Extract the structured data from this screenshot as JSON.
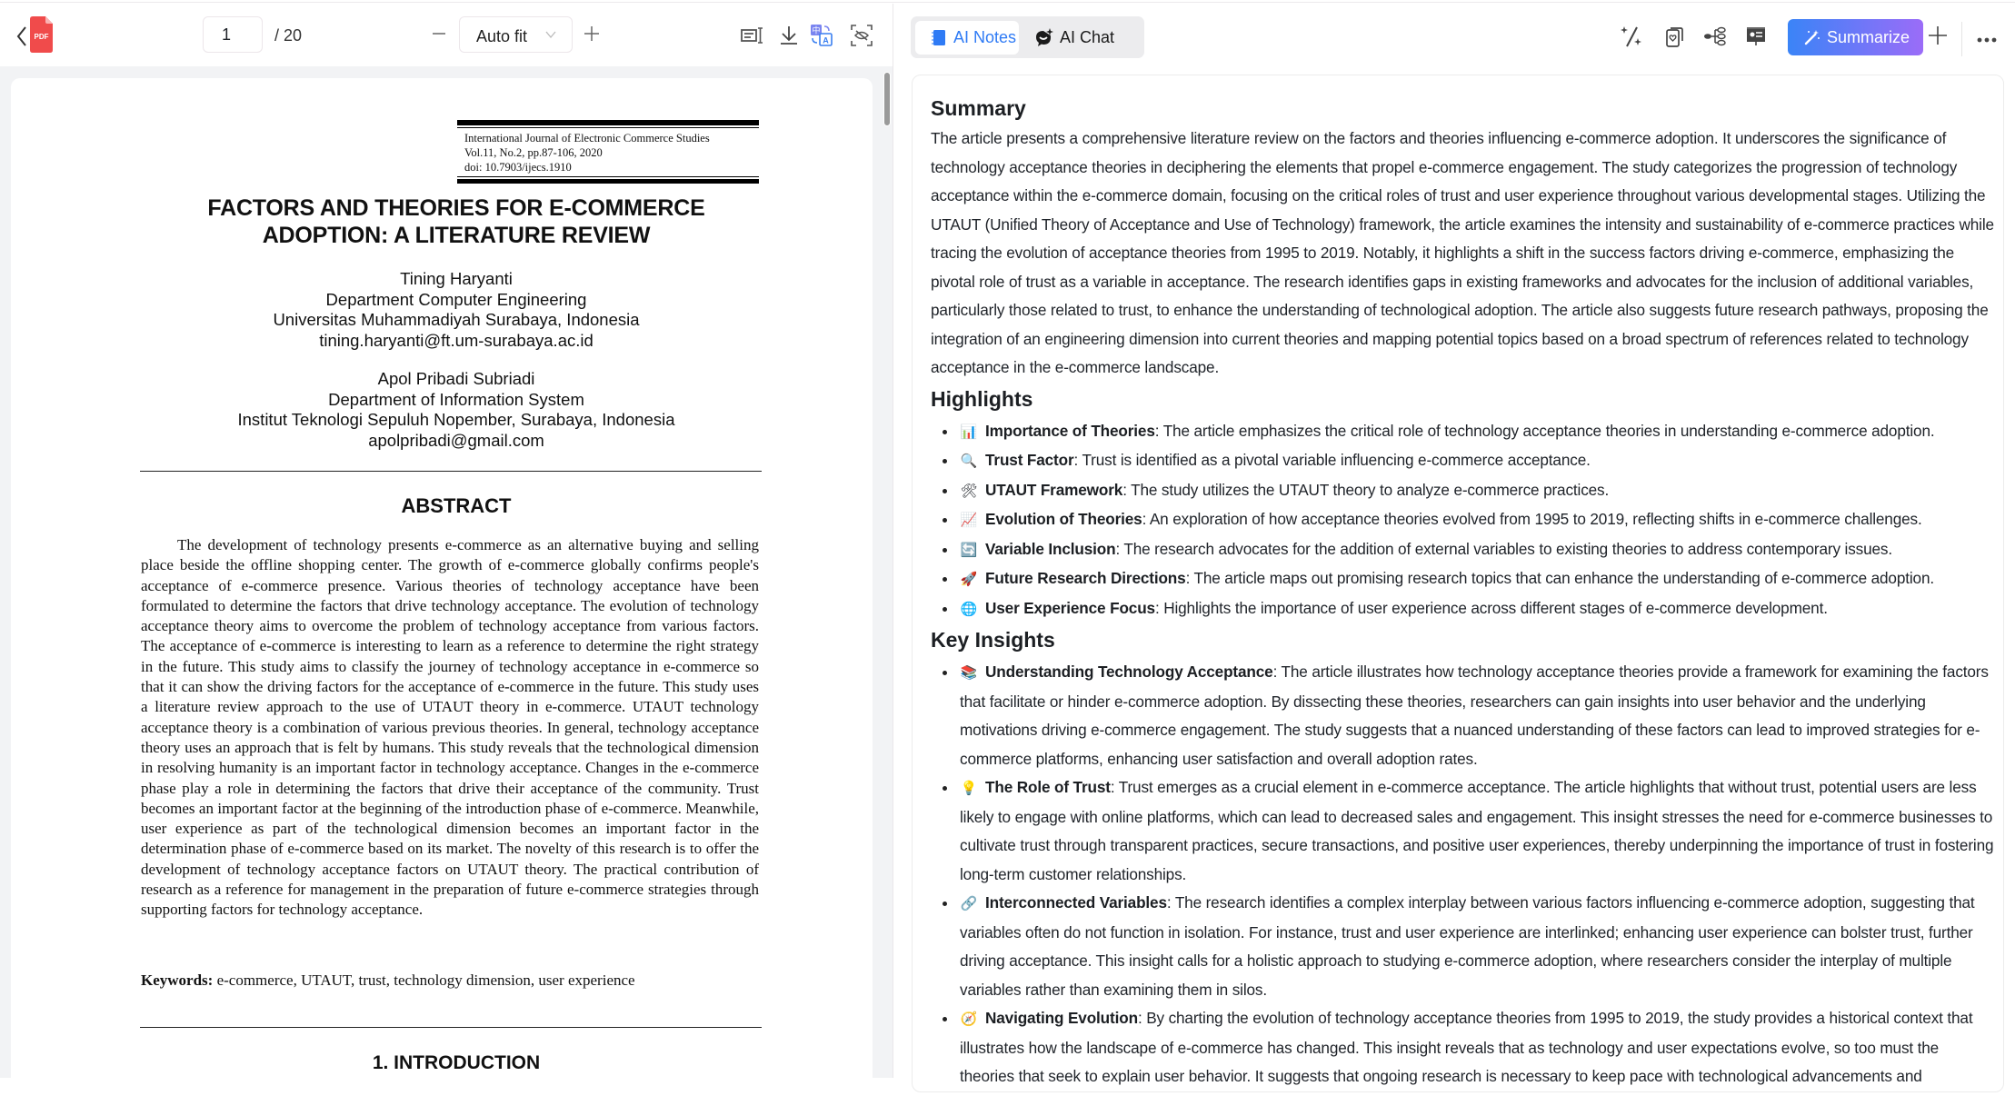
{
  "pdf_viewer": {
    "file_type_badge": "PDF",
    "current_page": "1",
    "total_pages": "/ 20",
    "zoom_level": "Auto fit",
    "toolbar_icons": [
      "text-select-icon",
      "download-icon",
      "translate-icon",
      "hide-icon"
    ]
  },
  "paper": {
    "journal": "International Journal of Electronic Commerce Studies",
    "volume": "Vol.11, No.2, pp.87-106, 2020",
    "doi": "doi: 10.7903/ijecs.1910",
    "title_line1": "FACTORS AND THEORIES FOR E-COMMERCE",
    "title_line2": "ADOPTION: A LITERATURE REVIEW",
    "authors": [
      {
        "name": "Tining Haryanti",
        "department": "Department Computer Engineering",
        "institution": "Universitas Muhammadiyah Surabaya, Indonesia",
        "email": "tining.haryanti@ft.um-surabaya.ac.id"
      },
      {
        "name": "Apol Pribadi Subriadi",
        "department": "Department of Information System",
        "institution": "Institut Teknologi Sepuluh Nopember, Surabaya, Indonesia",
        "email": "apolpribadi@gmail.com"
      }
    ],
    "abstract_heading": "ABSTRACT",
    "abstract": "The development of technology presents e-commerce as an alternative buying and selling place beside the offline shopping center. The growth of e-commerce globally confirms people's acceptance of e-commerce presence. Various theories of technology acceptance have been formulated to determine the factors that drive technology acceptance. The evolution of technology acceptance theory aims to overcome the problem of technology acceptance from various factors. The acceptance of e-commerce is interesting to learn as a reference to determine the right strategy in the future. This study aims to classify the journey of technology acceptance in e-commerce so that it can show the driving factors for the acceptance of e-commerce in the future. This study uses a literature review approach to the use of UTAUT theory in e-commerce. UTAUT technology acceptance theory is a combination of various previous theories. In general, technology acceptance theory uses an approach that is felt by humans. This study reveals that the technological dimension in resolving humanity is an important factor in technology acceptance. Changes in the e-commerce phase play a role in determining the factors that drive their acceptance of the community. Trust becomes an important factor at the beginning of the introduction phase of e-commerce. Meanwhile, user experience as part of the technological dimension becomes an important factor in the determination phase of e-commerce based on its market. The novelty of this research is to offer the development of technology acceptance factors on UTAUT theory. The practical contribution of research as a reference for management in the preparation of future e-commerce strategies through supporting factors for technology acceptance.",
    "keywords_label": "Keywords:",
    "keywords": " e-commerce, UTAUT, trust, technology dimension, user experience",
    "section1_heading": "1. INTRODUCTION"
  },
  "ai_panel": {
    "tabs": [
      {
        "label": "AI Notes",
        "active": true,
        "icon": "notebook-icon"
      },
      {
        "label": "AI Chat",
        "active": false,
        "icon": "chat-sparkle-icon"
      }
    ],
    "toolbar_icons": [
      "magic-sparkle-icon",
      "flashcards-icon",
      "mindmap-icon",
      "presentation-icon"
    ],
    "summarize_label": "Summarize",
    "accent_gradient": [
      "#3a84f7",
      "#9b6cf8"
    ],
    "active_tab_color": "#2f7bf5"
  },
  "notes": {
    "summary_heading": "Summary",
    "summary": "The article presents a comprehensive literature review on the factors and theories influencing e-commerce adoption. It underscores the significance of technology acceptance theories in deciphering the elements that propel e-commerce engagement. The study categorizes the progression of technol­ogy acceptance within the e-commerce domain, focusing on the critical roles of trust and user experience throughout various developmental stages. Utilizing the UTAUT (Unified Theory of Acceptance and Use of Technology) framework, the article examines the intensity and sustainability of e-com­merce practices while tracing the evolution of acceptance theories from 1995 to 2019. Notably, it highlights a shift in the success factors driving e-commerce, emphasizing the pivotal role of trust as a variable in acceptance. The research identifies gaps in existing frameworks and advocates for the inclusion of additional variables, particularly those related to trust, to enhance the understanding of technological adoption. The article also sug­gests future research pathways, proposing the integration of an engineering dimension into current theories and mapping potential topics based on a broad spectrum of references related to technology acceptance in the e-commerce landscape.",
    "highlights_heading": "Highlights",
    "highlights": [
      {
        "emoji": "📊",
        "title": "Importance of Theories",
        "text": ": The article emphasizes the critical role of technology acceptance theories in understanding e-commerce adoption."
      },
      {
        "emoji": "🔍",
        "title": "Trust Factor",
        "text": ": Trust is identified as a pivotal variable influencing e-commerce acceptance."
      },
      {
        "emoji": "🛠",
        "title": "UTAUT Framework",
        "text": ": The study utilizes the UTAUT theory to analyze e-commerce practices."
      },
      {
        "emoji": "📈",
        "title": "Evolution of Theories",
        "text": ": An exploration of how acceptance theories evolved from 1995 to 2019, reflecting shifts in e-commerce challenges."
      },
      {
        "emoji": "🔄",
        "title": "Variable Inclusion",
        "text": ": The research advocates for the addition of external variables to existing theories to address contemporary issues."
      },
      {
        "emoji": "🚀",
        "title": "Future Research Directions",
        "text": ": The article maps out promising research topics that can enhance the understanding of e-commerce adoption."
      },
      {
        "emoji": "🌐",
        "title": "User Experience Focus",
        "text": ": Highlights the importance of user experience across different stages of e-commerce development."
      }
    ],
    "insights_heading": "Key Insights",
    "insights": [
      {
        "emoji": "📚",
        "title": "Understanding Technology Acceptance",
        "text": ": The article illustrates how technology acceptance theories provide a framework for examining the factors that facilitate or hinder e-commerce adoption. By dissecting these theories, researchers can gain insights into user behavior and the un­derlying motivations driving e-commerce engagement. The study suggests that a nuanced understanding of these factors can lead to improved strategies for e-commerce platforms, enhancing user satisfaction and overall adoption rates."
      },
      {
        "emoji": "💡",
        "title": "The Role of Trust",
        "text": ": Trust emerges as a crucial element in e-commerce acceptance. The article highlights that without trust, potential users are less likely to engage with online platforms, which can lead to decreased sales and engagement. This insight stresses the need for e-commerce businesses to cultivate trust through transparent practices, secure transactions, and positive user experiences, thereby underpinning the impor­tance of trust in fostering long-term customer relationships."
      },
      {
        "emoji": "🔗",
        "title": "Interconnected Variables",
        "text": ": The research identifies a complex interplay between various factors influencing e-commerce adoption, suggesting that variables often do not function in isolation. For instance, trust and user experience are interlinked; enhancing user experience can bolster trust, further driving acceptance. This insight calls for a holistic approach to studying e-commerce adoption, where researchers consider the inter­play of multiple variables rather than examining them in silos."
      },
      {
        "emoji": "🧭",
        "title": "Navigating Evolution",
        "text": ": By charting the evolution of technology acceptance theories from 1995 to 2019, the study provides a historical context that illustrates how the landscape of e-commerce has changed. This insight reveals that as technology and user expectations evolve, so too must the theories that seek to explain user behavior. It suggests that ongoing research is necessary to keep pace with technological advancements and"
      }
    ]
  }
}
